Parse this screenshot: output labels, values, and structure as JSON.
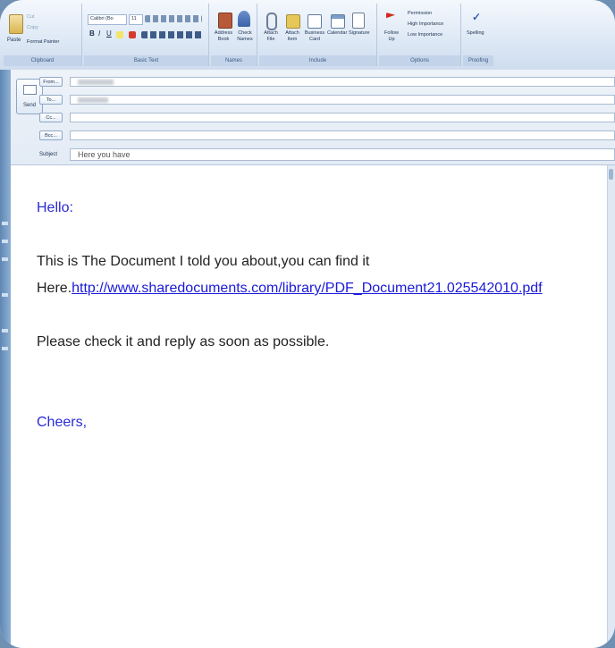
{
  "ribbon": {
    "clipboard": {
      "paste": "Paste",
      "cut": "Cut",
      "copy": "Copy",
      "format_painter": "Format Painter",
      "group": "Clipboard"
    },
    "basic_text": {
      "font": "Calibri (Bo",
      "size": "11",
      "group": "Basic Text"
    },
    "names": {
      "address_book": "Address Book",
      "check_names": "Check Names",
      "group": "Names"
    },
    "include": {
      "attach_file": "Attach File",
      "attach_item": "Attach Item",
      "business_card": "Business Card",
      "calendar": "Calendar",
      "signature": "Signature",
      "group": "Include"
    },
    "options": {
      "follow_up": "Follow Up",
      "permission": "Permission",
      "high_importance": "High Importance",
      "low_importance": "Low Importance",
      "group": "Options"
    },
    "proofing": {
      "spelling": "Spelling",
      "group": "Proofing"
    }
  },
  "header": {
    "send": "Send",
    "from": "From...",
    "to": "To...",
    "cc": "Cc...",
    "bcc": "Bcc...",
    "subject_label": "Subject",
    "subject_value": "Here you have"
  },
  "message": {
    "greeting": "Hello:",
    "line1": "This is The Document I told you about,you can find it",
    "here": "Here.",
    "link": "http://www.sharedocuments.com/library/PDF_Document21.025542010.pdf",
    "line2": "Please check it and reply as soon as possible.",
    "closing": "Cheers,"
  },
  "colors": {
    "greeting": "#2a2ad6",
    "link": "#1a1ad8",
    "ribbon": "#dde8f5"
  }
}
